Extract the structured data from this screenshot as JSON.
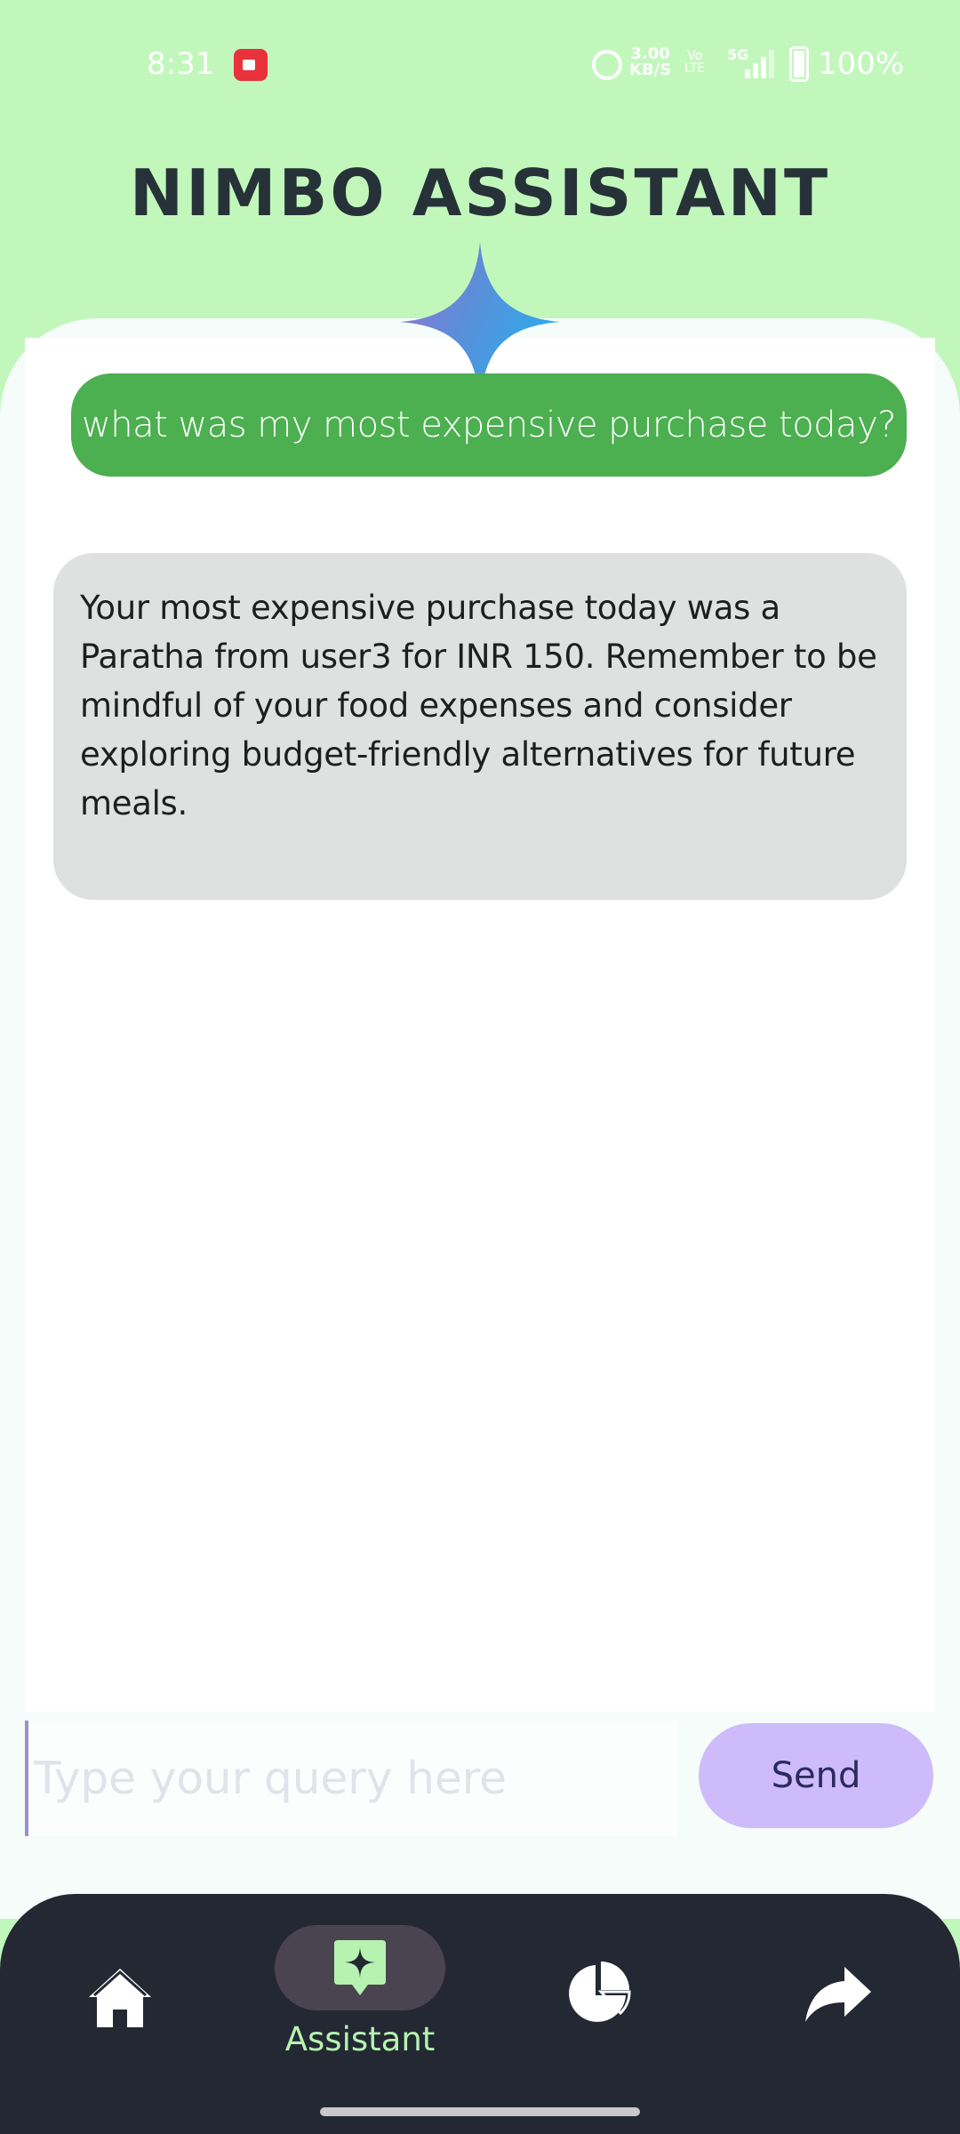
{
  "status_bar": {
    "time": "8:31",
    "speed_value": "3.00",
    "speed_unit": "KB/S",
    "volte_top": "Vo",
    "volte_bottom": "LTE",
    "network": "5G",
    "battery": "100%",
    "icons": [
      "screen-record-icon",
      "alarm-icon",
      "signal-icon",
      "battery-icon"
    ]
  },
  "header": {
    "title": "NIMBO ASSISTANT"
  },
  "chat": {
    "messages": [
      {
        "role": "user",
        "text": "what was my most expensive purchase today?"
      },
      {
        "role": "assistant",
        "text": "Your most expensive purchase today was a Paratha from user3 for INR 150.  Remember to be mindful of your food expenses and consider exploring budget-friendly alternatives for future meals."
      }
    ]
  },
  "composer": {
    "placeholder": "Type your query here",
    "value": "",
    "send_label": "Send"
  },
  "bottom_nav": {
    "items": [
      {
        "icon": "home-icon",
        "label": ""
      },
      {
        "icon": "assistant-sparkle-icon",
        "label": "Assistant",
        "active": true
      },
      {
        "icon": "pie-chart-icon",
        "label": ""
      },
      {
        "icon": "share-arrow-icon",
        "label": ""
      }
    ]
  },
  "colors": {
    "header_bg": "#c2f7bc",
    "user_bubble": "#4caf50",
    "assistant_bubble": "#dfe0e0",
    "send_button": "#cdbbfb",
    "nav_bg": "#232833",
    "nav_active_label": "#b6f2b0"
  }
}
